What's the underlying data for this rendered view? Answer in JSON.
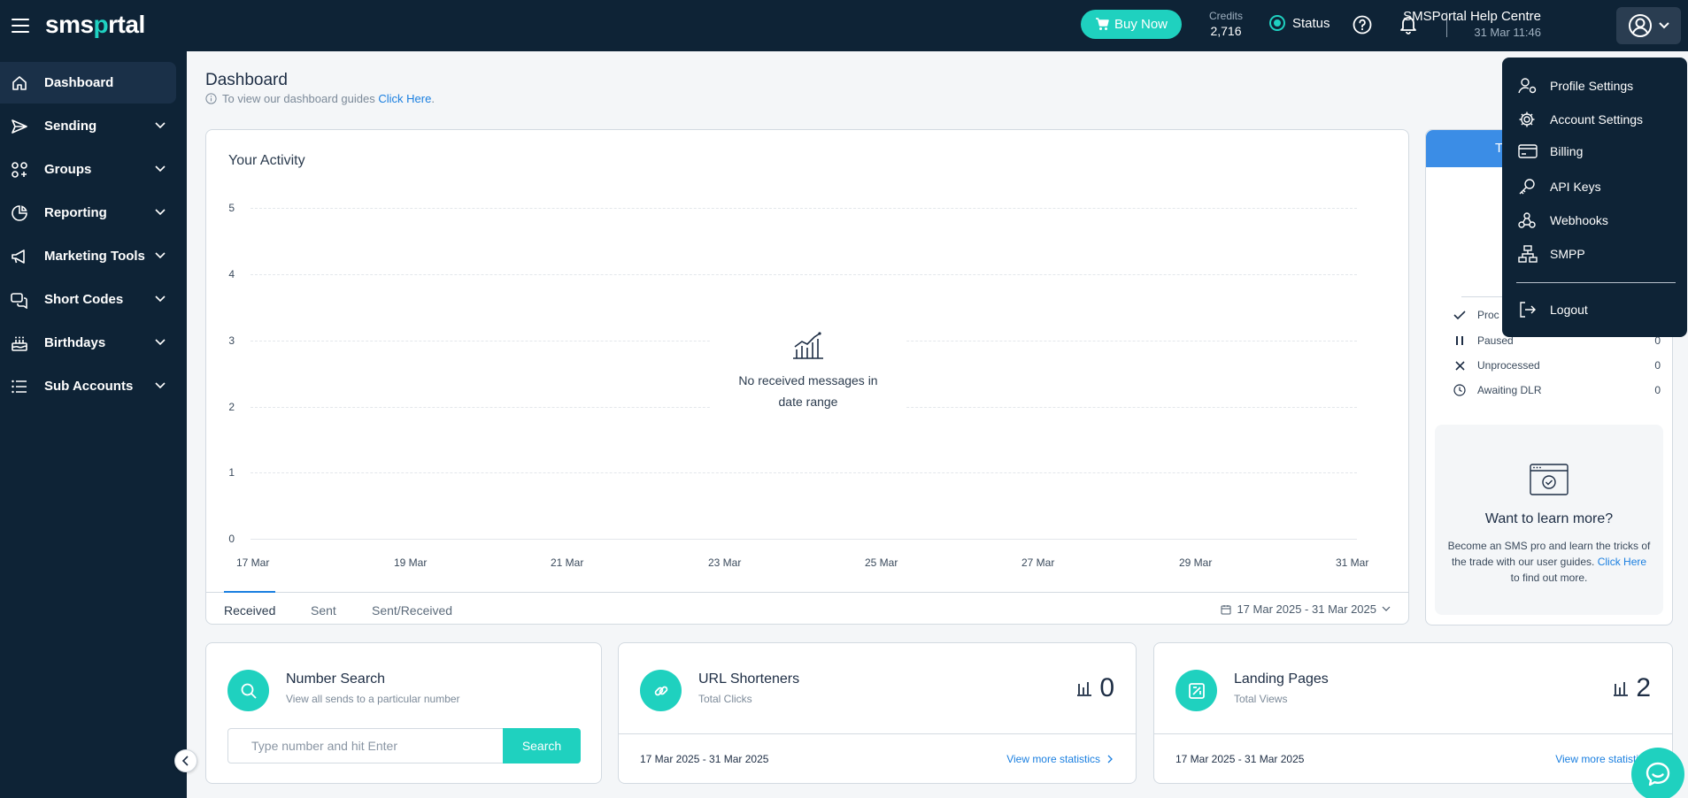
{
  "header": {
    "logo_prefix": "sms",
    "logo_o": "p",
    "logo_suffix": "rtal",
    "buy_now": "Buy Now",
    "credits_label": "Credits",
    "credits_value": "2,716",
    "status_label": "Status",
    "help_centre": "SMSPortal Help Centre",
    "datetime": "31 Mar 11:46"
  },
  "sidebar": {
    "items": [
      {
        "label": "Dashboard"
      },
      {
        "label": "Sending"
      },
      {
        "label": "Groups"
      },
      {
        "label": "Reporting"
      },
      {
        "label": "Marketing Tools"
      },
      {
        "label": "Short Codes"
      },
      {
        "label": "Birthdays"
      },
      {
        "label": "Sub Accounts"
      }
    ]
  },
  "page": {
    "title": "Dashboard",
    "guide_text": "To view our dashboard guides",
    "guide_link": "Click Here",
    "guide_end": "."
  },
  "activity": {
    "title": "Your Activity",
    "y_ticks": [
      "5",
      "4",
      "3",
      "2",
      "1",
      "0"
    ],
    "x_ticks": [
      "17 Mar",
      "19 Mar",
      "21 Mar",
      "23 Mar",
      "25 Mar",
      "27 Mar",
      "29 Mar",
      "31 Mar"
    ],
    "no_data_line1": "No received messages in",
    "no_data_line2": "date range",
    "tabs": [
      "Received",
      "Sent",
      "Sent/Received"
    ],
    "date_range": "17 Mar 2025 - 31 Mar 2025"
  },
  "summary": {
    "tab_partial": "T",
    "rows": [
      {
        "label": "Proc",
        "value": ""
      },
      {
        "label": "Paused",
        "value": "0"
      },
      {
        "label": "Unprocessed",
        "value": "0"
      },
      {
        "label": "Awaiting DLR",
        "value": "0"
      }
    ],
    "learn_title": "Want to learn more?",
    "learn_text": "Become an SMS pro and learn the tricks of the trade with our user guides.",
    "learn_link": "Click Here",
    "learn_end": "to find out more."
  },
  "number_search": {
    "title": "Number Search",
    "subtitle": "View all sends to a particular number",
    "placeholder": "Type number and hit Enter",
    "button": "Search"
  },
  "url_shorteners": {
    "title": "URL Shorteners",
    "subtitle": "Total Clicks",
    "count": "0",
    "date": "17 Mar 2025 - 31 Mar 2025",
    "link": "View more statistics"
  },
  "landing_pages": {
    "title": "Landing Pages",
    "subtitle": "Total Views",
    "count": "2",
    "date": "17 Mar 2025 - 31 Mar 2025",
    "link": "View more statistics"
  },
  "user_menu": {
    "items": [
      "Profile Settings",
      "Account Settings",
      "Billing",
      "API Keys",
      "Webhooks",
      "SMPP"
    ],
    "logout": "Logout"
  },
  "colors": {
    "navy": "#0e2336",
    "teal": "#1fd1bf",
    "link_blue": "#1a7fe0",
    "tab_blue": "#3b8de6"
  }
}
